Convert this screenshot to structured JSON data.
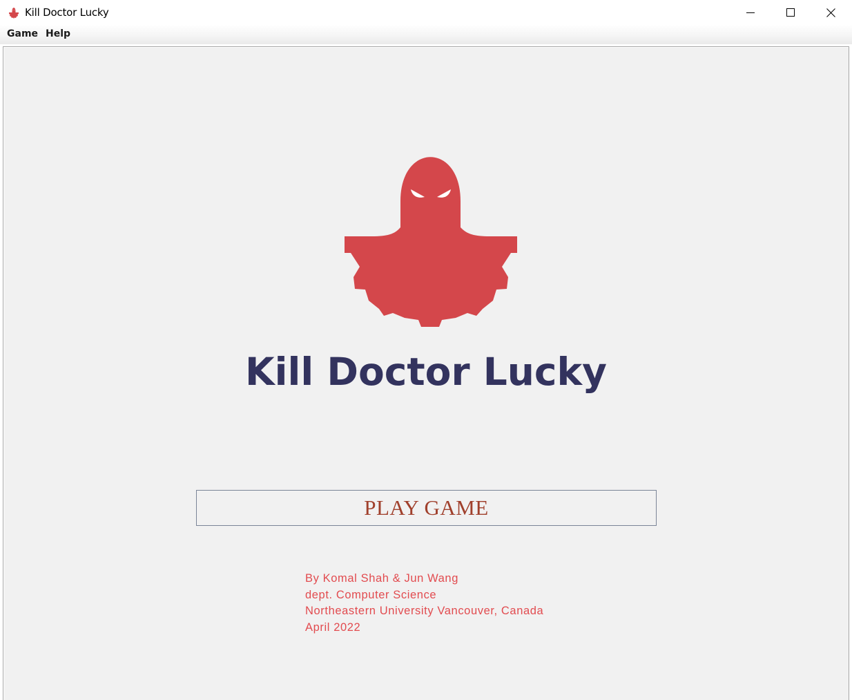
{
  "window": {
    "title": "Kill Doctor Lucky",
    "controls": [
      "minimize-icon",
      "maximize-icon",
      "close-icon"
    ]
  },
  "menu": {
    "items": [
      {
        "label": "Game"
      },
      {
        "label": "Help"
      }
    ]
  },
  "main": {
    "logo_icon": "ghost-gear-logo",
    "game_title": "Kill Doctor Lucky",
    "play_button_label": "PLAY GAME",
    "credits": [
      "By Komal Shah & Jun Wang",
      "dept. Computer Science",
      "Northeastern University Vancouver, Canada",
      "April 2022"
    ]
  },
  "colors": {
    "logo_red": "#d4474b",
    "title_navy": "#33335e",
    "button_text": "#a0402c",
    "credits_text": "#e24b4f",
    "content_bg": "#f1f1f1"
  }
}
